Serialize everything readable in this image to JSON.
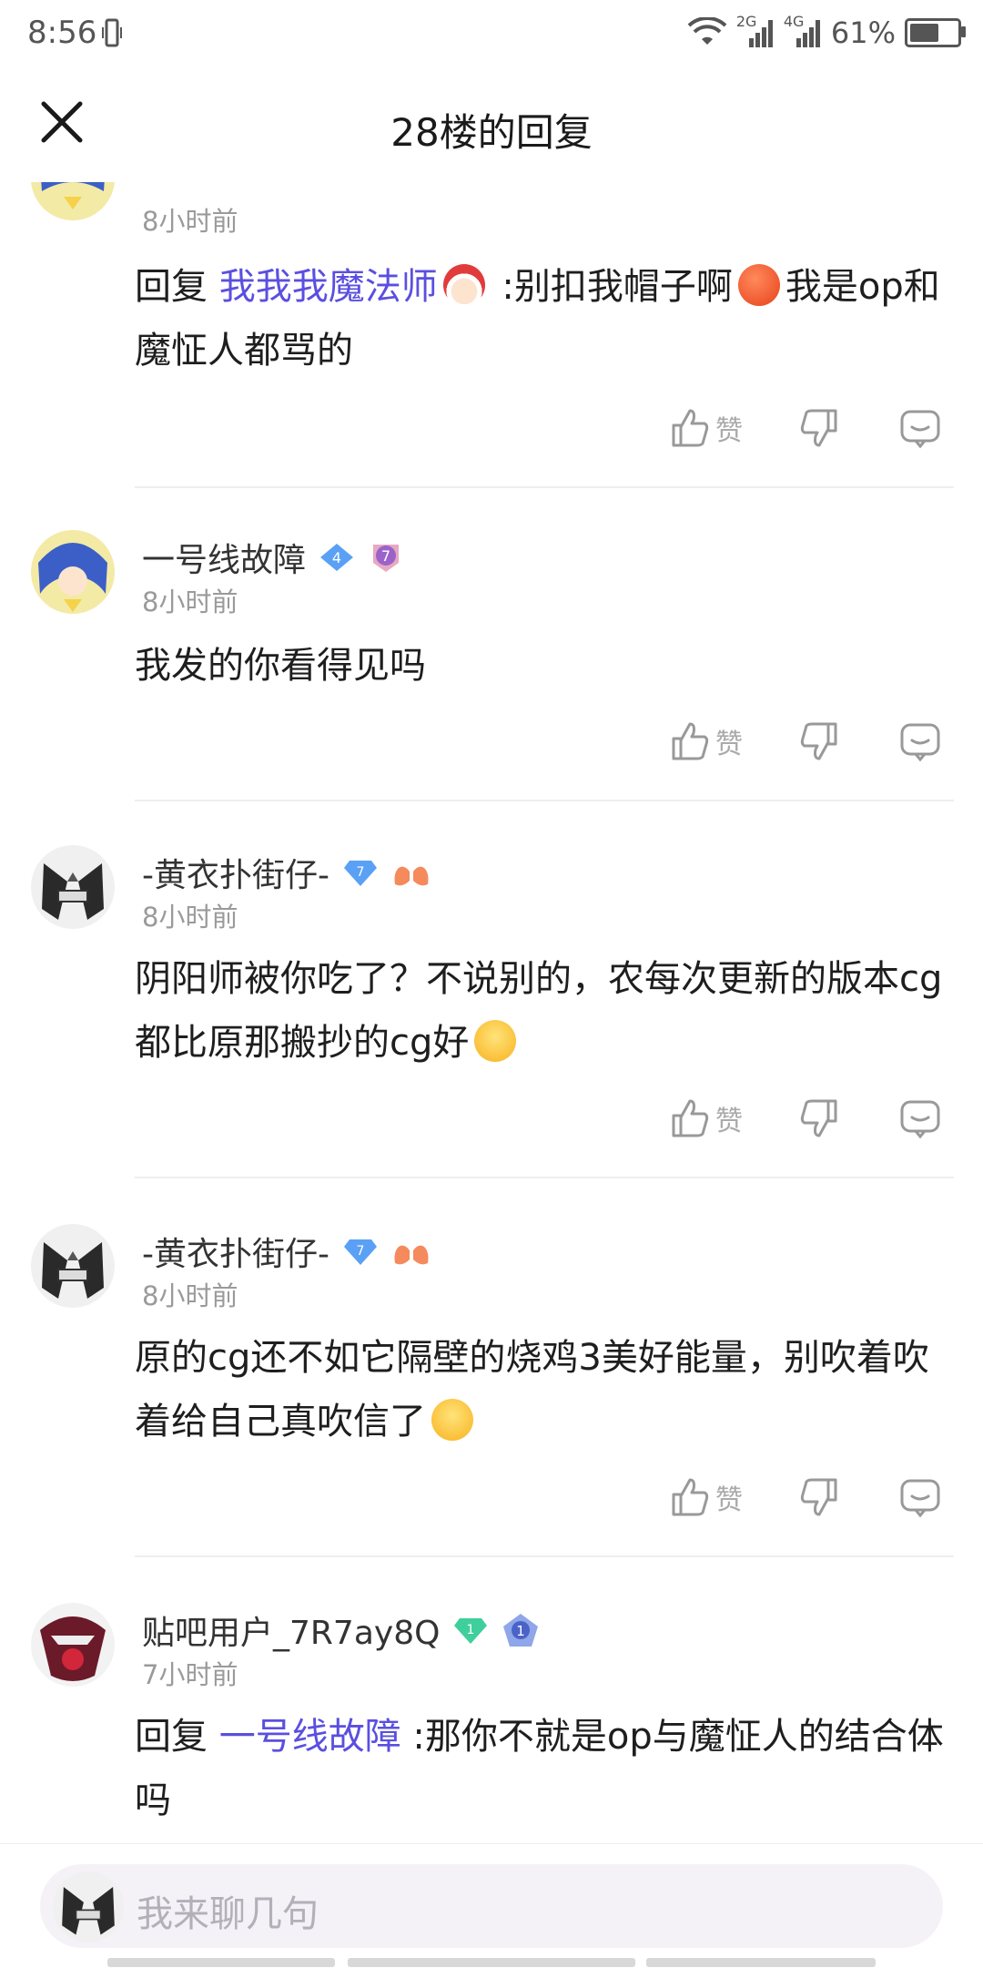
{
  "status_bar": {
    "time": "8:56",
    "signal_1": "2G",
    "signal_2": "4G",
    "battery": "61%",
    "battery_level": 0.61
  },
  "header": {
    "title": "28楼的回复",
    "close_icon": "close-icon"
  },
  "replies": [
    {
      "name": "",
      "time": "8小时前",
      "content_prefix": "回复 ",
      "mention": "我我我魔法师",
      "content_after_mention": " :别扣我帽子啊",
      "content_after_emoji": "我是op和魔怔人都骂的",
      "like_label": "赞"
    },
    {
      "name": "一号线故障",
      "level": "4",
      "medal": "7",
      "time": "8小时前",
      "content": "我发的你看得见吗",
      "like_label": "赞"
    },
    {
      "name": "-黄衣扑街仔-",
      "level": "7",
      "time": "8小时前",
      "content": "阴阳师被你吃了？不说别的，农每次更新的版本cg都比原那搬抄的cg好",
      "like_label": "赞"
    },
    {
      "name": "-黄衣扑街仔-",
      "level": "7",
      "time": "8小时前",
      "content": "原的cg还不如它隔壁的烧鸡3美好能量，别吹着吹着给自己真吹信了",
      "like_label": "赞"
    },
    {
      "name": "贴吧用户_7R7ay8Q",
      "level": "1",
      "medal": "1",
      "time": "7小时前",
      "content_prefix": "回复 ",
      "mention": "一号线故障",
      "content_after_mention": " :那你不就是op与魔怔人的结合体吗"
    }
  ],
  "input": {
    "placeholder": "我来聊几句"
  },
  "colors": {
    "mention": "#5a4fe0",
    "timestamp": "#9a9a9a",
    "divider": "#eeeeee",
    "badge_blue": "#5aa0f5",
    "badge_green": "#3ecf9c"
  }
}
